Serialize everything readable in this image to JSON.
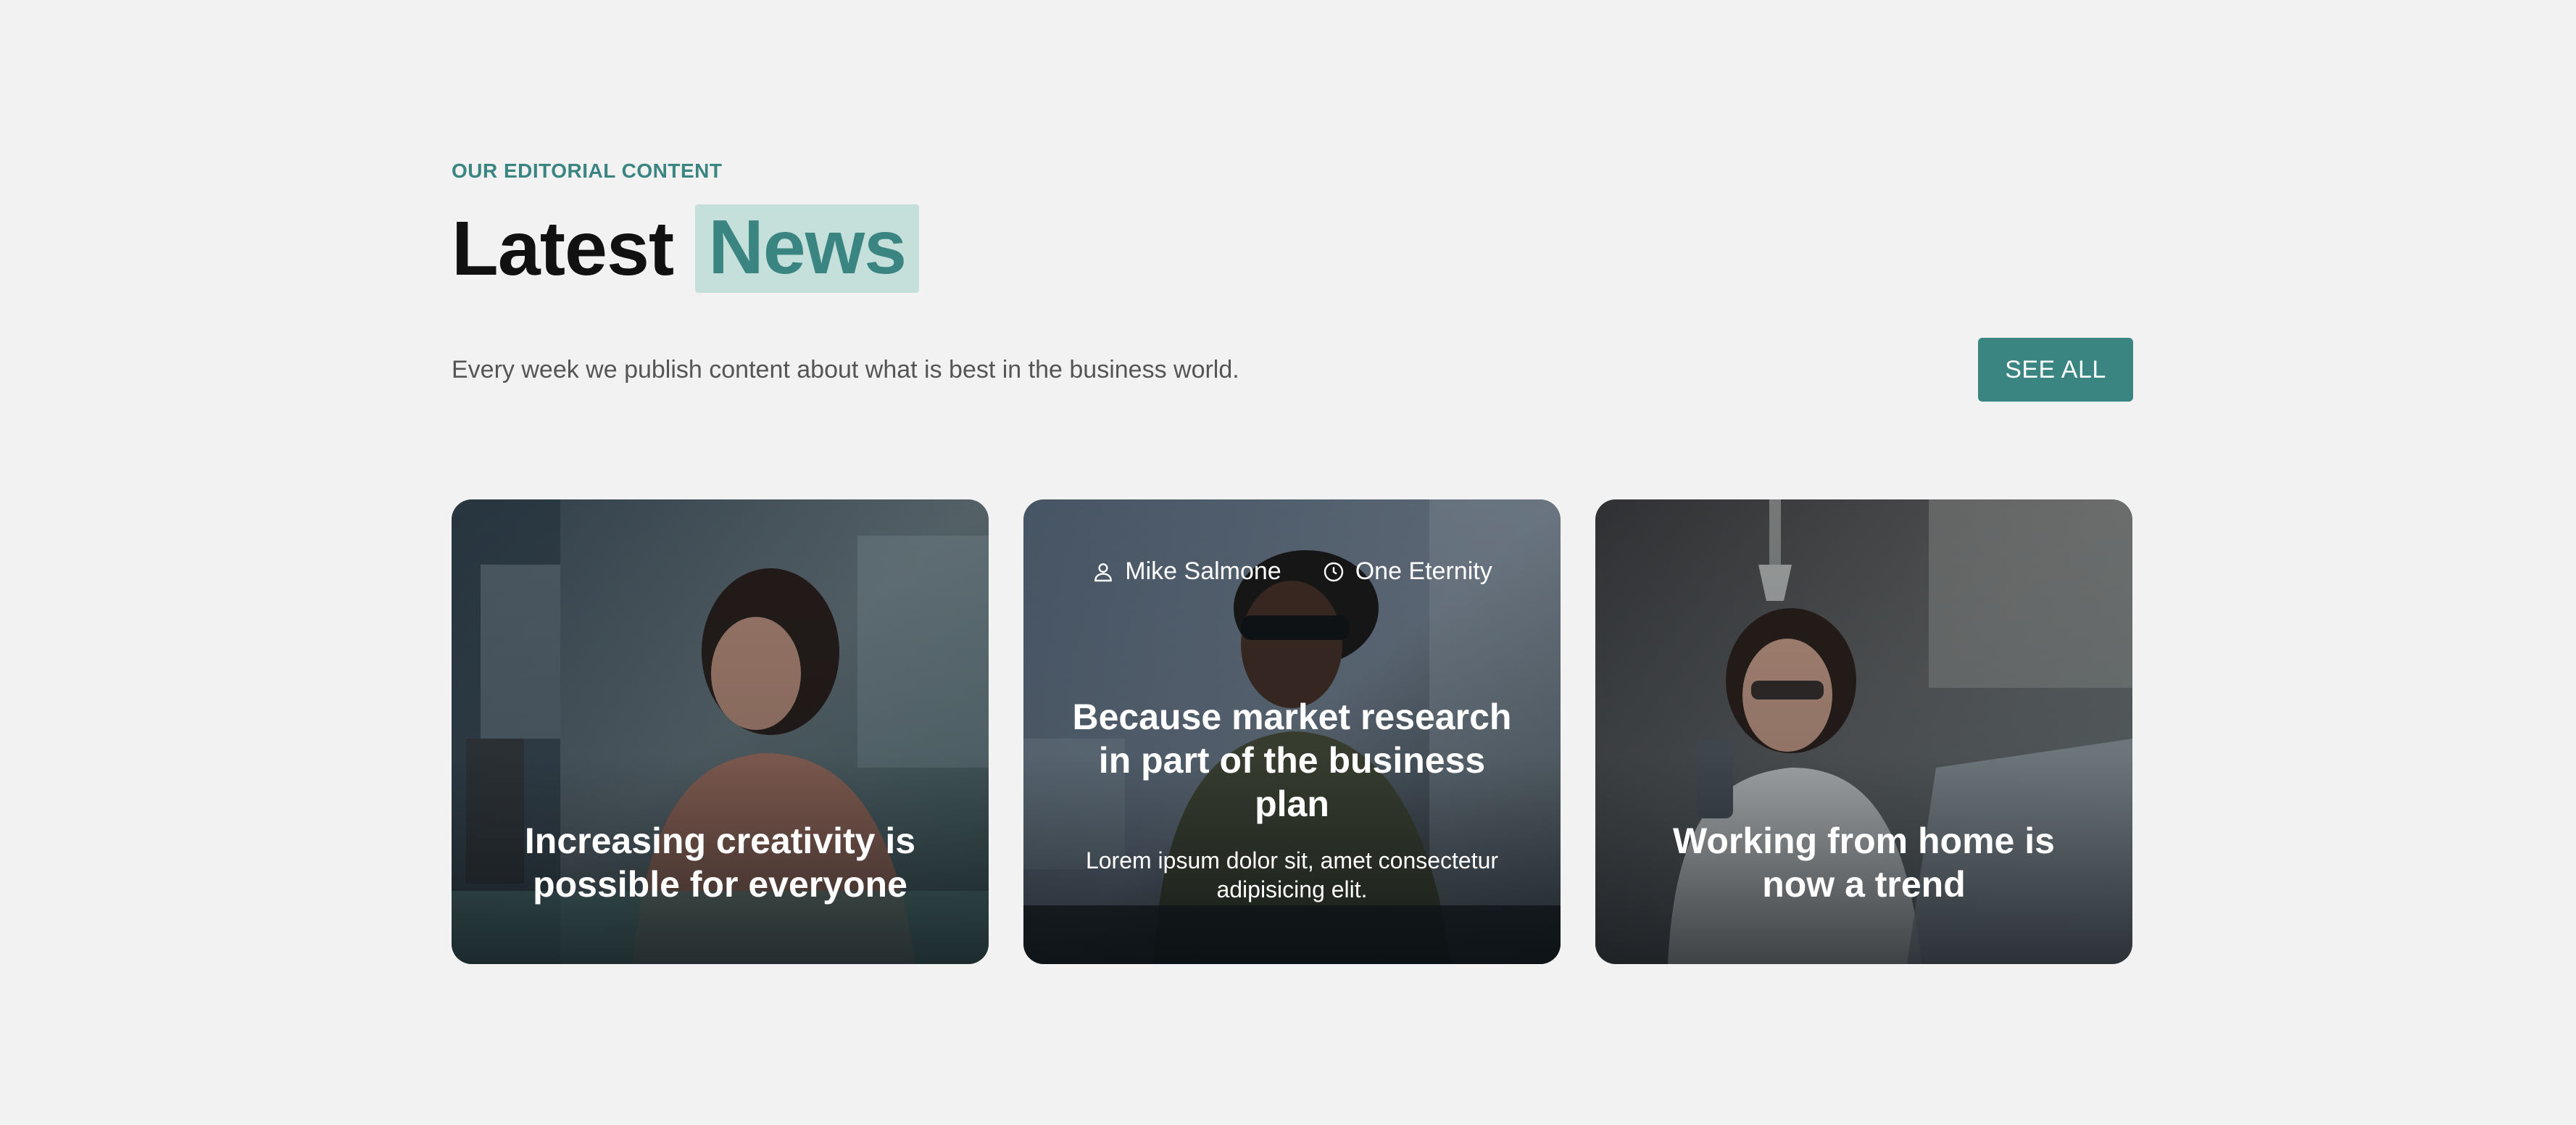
{
  "header": {
    "eyebrow": "OUR EDITORIAL CONTENT",
    "title_plain": "Latest",
    "title_highlight": "News",
    "subtitle": "Every week we publish content about what is best in the business world.",
    "see_all_label": "SEE ALL"
  },
  "colors": {
    "accent": "#3a8481",
    "accent_light": "#c5dfdb",
    "background": "#f2f2f2"
  },
  "cards": [
    {
      "title": "Increasing creativity is possible for everyone",
      "image": "woman-drawing-photo"
    },
    {
      "author": "Mike Salmone",
      "time": "One Eternity",
      "author_icon": "user-icon",
      "time_icon": "clock-icon",
      "title": "Because market research in part of the business plan",
      "description": "Lorem ipsum dolor sit, amet consectetur adipisicing elit.",
      "image": "man-with-sunglasses-photo"
    },
    {
      "title": "Working from home is now a trend",
      "image": "woman-with-phone-photo"
    }
  ]
}
